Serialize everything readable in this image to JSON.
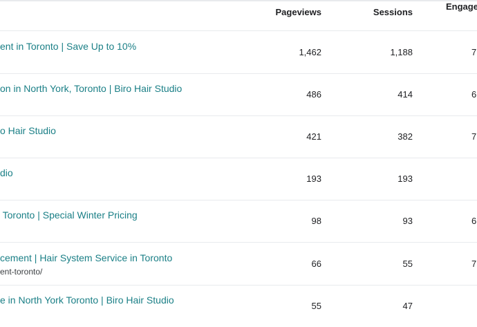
{
  "columns": {
    "pageviews": "Pageviews",
    "sessions": "Sessions",
    "engagement": "Engage"
  },
  "rows": [
    {
      "title": "ent in Toronto | Save Up to 10%",
      "subtitle": "",
      "pageviews": "1,462",
      "sessions": "1,188",
      "engagement": "7"
    },
    {
      "title": "on in North York, Toronto | Biro Hair Studio",
      "subtitle": "",
      "pageviews": "486",
      "sessions": "414",
      "engagement": "6"
    },
    {
      "title": "o Hair Studio",
      "subtitle": "",
      "pageviews": "421",
      "sessions": "382",
      "engagement": "7"
    },
    {
      "title": "dio",
      "subtitle": "",
      "pageviews": "193",
      "sessions": "193",
      "engagement": ""
    },
    {
      "title": " Toronto | Special Winter Pricing",
      "subtitle": "",
      "pageviews": "98",
      "sessions": "93",
      "engagement": "6"
    },
    {
      "title": "cement | Hair System Service in Toronto",
      "subtitle": "ent-toronto/",
      "pageviews": "66",
      "sessions": "55",
      "engagement": "7"
    },
    {
      "title": "e in North York Toronto | Biro Hair Studio",
      "subtitle": "",
      "pageviews": "55",
      "sessions": "47",
      "engagement": ""
    }
  ],
  "colors": {
    "link": "#1a7f86",
    "divider": "#e8eaed"
  }
}
